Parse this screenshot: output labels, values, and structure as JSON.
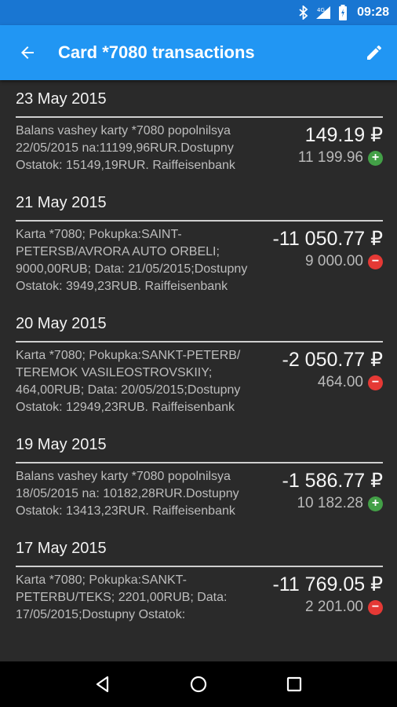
{
  "status_bar": {
    "time": "09:28",
    "icons": [
      "bluetooth-icon",
      "signal-icon",
      "battery-icon"
    ]
  },
  "app_bar": {
    "title": "Card *7080 transactions",
    "back_icon": "arrow-back-icon",
    "edit_icon": "pencil-icon"
  },
  "groups": [
    {
      "date": "23 May 2015",
      "transactions": [
        {
          "description": "Balans vashey karty *7080 popolnilsya 22/05/2015 na:11199,96RUR.Dostupny Ostatok: 15149,19RUR. Raiffeisenbank",
          "amount": "149.19 ₽",
          "sub_amount": "11 199.96",
          "type": "plus"
        }
      ]
    },
    {
      "date": "21 May 2015",
      "transactions": [
        {
          "description": "Karta *7080; Pokupka:SAINT-PETERSB/AVRORA AUTO ORBELI; 9000,00RUB; Data: 21/05/2015;Dostupny Ostatok: 3949,23RUB. Raiffeisenbank",
          "amount": "-11 050.77 ₽",
          "sub_amount": "9 000.00",
          "type": "minus"
        }
      ]
    },
    {
      "date": "20 May 2015",
      "transactions": [
        {
          "description": "Karta *7080; Pokupka:SANKT-PETERB/ TEREMOK VASILEOSTROVSKIIY; 464,00RUB; Data: 20/05/2015;Dostupny Ostatok: 12949,23RUB. Raiffeisenbank",
          "amount": "-2 050.77 ₽",
          "sub_amount": "464.00",
          "type": "minus"
        }
      ]
    },
    {
      "date": "19 May 2015",
      "transactions": [
        {
          "description": "Balans vashey karty *7080 popolnilsya 18/05/2015 na: 10182,28RUR.Dostupny Ostatok: 13413,23RUR. Raiffeisenbank",
          "amount": "-1 586.77 ₽",
          "sub_amount": "10 182.28",
          "type": "plus"
        }
      ]
    },
    {
      "date": "17 May 2015",
      "transactions": [
        {
          "description": "Karta *7080; Pokupka:SANKT-PETERBU/TEKS; 2201,00RUB; Data: 17/05/2015;Dostupny Ostatok:",
          "amount": "-11 769.05 ₽",
          "sub_amount": "2 201.00",
          "type": "minus"
        }
      ]
    }
  ],
  "nav_bar": {
    "icons": [
      "back-triangle-icon",
      "home-circle-icon",
      "recents-square-icon"
    ]
  },
  "colors": {
    "status_bar": "#1976d2",
    "app_bar": "#2196f3",
    "background": "#2a2a2a",
    "plus_badge": "#43a047",
    "minus_badge": "#e53935"
  }
}
